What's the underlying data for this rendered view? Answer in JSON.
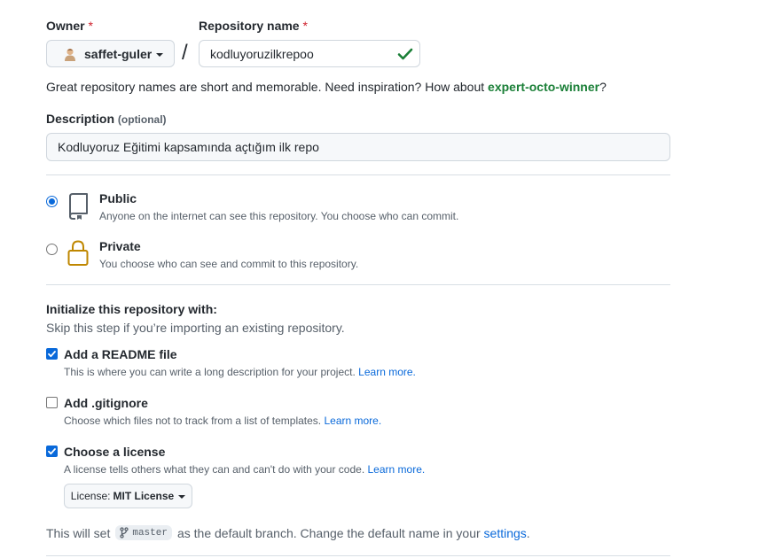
{
  "owner": {
    "label": "Owner",
    "required_mark": "*",
    "username": "saffet-guler"
  },
  "repo": {
    "label": "Repository name",
    "required_mark": "*",
    "value": "kodluyoruzilkrepoo",
    "separator": "/"
  },
  "name_hint": {
    "text": "Great repository names are short and memorable. Need inspiration? How about ",
    "suggestion": "expert-octo-winner",
    "end": "?"
  },
  "description": {
    "label": "Description",
    "optional": "(optional)",
    "value": "Kodluyoruz Eğitimi kapsamında açtığım ilk repo"
  },
  "visibility": {
    "selected": "public",
    "public": {
      "title": "Public",
      "sub": "Anyone on the internet can see this repository. You choose who can commit."
    },
    "private": {
      "title": "Private",
      "sub": "You choose who can see and commit to this repository."
    }
  },
  "init": {
    "title": "Initialize this repository with:",
    "sub": "Skip this step if you’re importing an existing repository.",
    "readme": {
      "checked": true,
      "title": "Add a README file",
      "sub": "This is where you can write a long description for your project.",
      "link": "Learn more."
    },
    "gitignore": {
      "checked": false,
      "title": "Add .gitignore",
      "sub": "Choose which files not to track from a list of templates.",
      "link": "Learn more."
    },
    "license": {
      "checked": true,
      "title": "Choose a license",
      "sub": "A license tells others what they can and can't do with your code.",
      "link": "Learn more."
    }
  },
  "license_select": {
    "prefix": "License:",
    "value": "MIT License"
  },
  "branch": {
    "before": "This will set",
    "name": "master",
    "after": "as the default branch. Change the default name in your",
    "link": "settings",
    "end": "."
  },
  "colors": {
    "accent": "#0969da",
    "success": "#1a7f37",
    "danger": "#cf222e",
    "lock": "#bf8700"
  }
}
